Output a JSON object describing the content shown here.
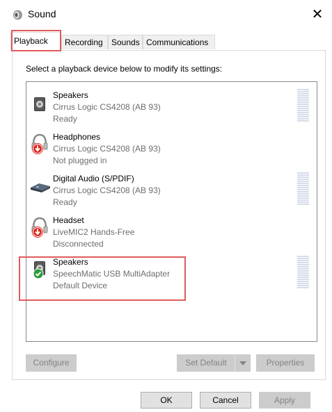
{
  "window": {
    "title": "Sound",
    "close_glyph": "✕"
  },
  "tabs": [
    {
      "label": "Playback",
      "selected": true
    },
    {
      "label": "Recording",
      "selected": false
    },
    {
      "label": "Sounds",
      "selected": false
    },
    {
      "label": "Communications",
      "selected": false
    }
  ],
  "instruction": "Select a playback device below to modify its settings:",
  "devices": [
    {
      "name": "Speakers",
      "description": "Cirrus Logic CS4208 (AB 93)",
      "status": "Ready",
      "icon": "speaker-icon",
      "has_meter": true
    },
    {
      "name": "Headphones",
      "description": "Cirrus Logic CS4208 (AB 93)",
      "status": "Not plugged in",
      "icon": "headphones-icon",
      "badge": "unplugged-arrow-badge",
      "has_meter": false
    },
    {
      "name": "Digital Audio (S/PDIF)",
      "description": "Cirrus Logic CS4208 (AB 93)",
      "status": "Ready",
      "icon": "digital-audio-icon",
      "has_meter": true
    },
    {
      "name": "Headset",
      "description": "LiveMIC2 Hands-Free",
      "status": "Disconnected",
      "icon": "headset-icon",
      "badge": "unplugged-arrow-badge",
      "has_meter": false
    },
    {
      "name": "Speakers",
      "description": "SpeechMatic USB MultiAdapter",
      "status": "Default Device",
      "icon": "speaker-icon",
      "badge": "default-check-badge",
      "has_meter": true
    }
  ],
  "buttons": {
    "configure": "Configure",
    "set_default": "Set Default",
    "properties": "Properties",
    "ok": "OK",
    "cancel": "Cancel",
    "apply": "Apply"
  },
  "colors": {
    "highlight": "#e05a5a",
    "disabled_button": "#cccccc",
    "meter": "#d5dce9",
    "check_green": "#2a9b3a",
    "badge_red": "#d9261c"
  }
}
